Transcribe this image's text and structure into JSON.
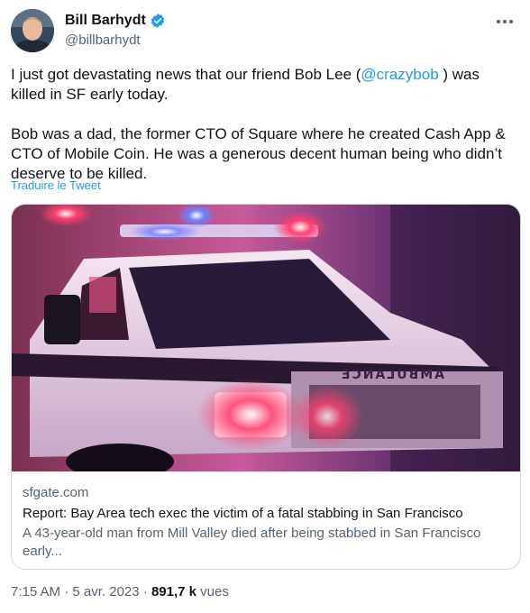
{
  "author": {
    "name": "Bill Barhydt",
    "handle": "@billbarhydt"
  },
  "tweet": {
    "para1_before": "I just got devastating news that our friend Bob Lee (",
    "para1_mention": "@crazybob",
    "para1_after": " ) was killed in SF early today.",
    "para2": "Bob was a dad, the former CTO of Square where he created Cash App & CTO of Mobile Coin.  He was a generous decent human being who didn’t deserve to be killed.",
    "translate_label": "Traduire le Tweet"
  },
  "card": {
    "domain": "sfgate.com",
    "title": "Report: Bay Area tech exec the victim of a fatal stabbing in San Francisco",
    "description": "A 43-year-old man from Mill Valley died after being stabbed in San Francisco early...",
    "image_text": "AMBULANCE"
  },
  "meta": {
    "time": "7:15 AM",
    "sep1": " · ",
    "date": "5 avr. 2023",
    "sep2": " · ",
    "views": "891,7 k",
    "views_label": " vues"
  },
  "colors": {
    "accent": "#1d9bf0",
    "text": "#0f1419",
    "secondary": "#536471",
    "border": "#cfd9de"
  },
  "icons": [
    "verified-badge-icon",
    "more-options-icon"
  ]
}
